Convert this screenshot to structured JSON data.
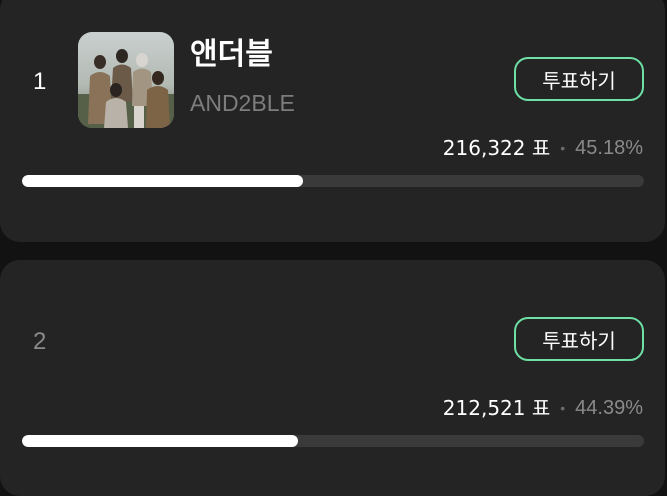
{
  "candidates": [
    {
      "rank": "1",
      "name_ko": "앤더블",
      "name_en": "AND2BLE",
      "vote_label": "투표하기",
      "votes": "216,322 표",
      "separator": "•",
      "percent": "45.18%",
      "progress": 0.4518
    },
    {
      "rank": "2",
      "vote_label": "투표하기",
      "votes": "212,521 표",
      "separator": "•",
      "percent": "44.39%",
      "progress": 0.4439
    }
  ],
  "colors": {
    "background": "#121212",
    "card": "#242424",
    "accent_green": "#6fe0a5",
    "bar_track": "#3a3a3a",
    "bar_fill": "#ffffff"
  }
}
